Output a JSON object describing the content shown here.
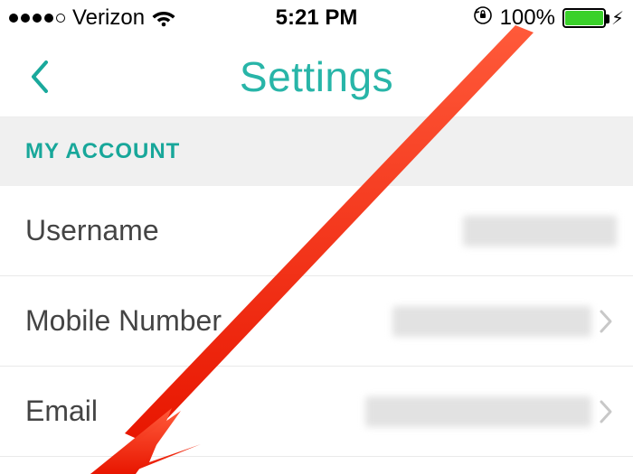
{
  "status_bar": {
    "carrier": "Verizon",
    "time": "5:21 PM",
    "battery_pct": "100%",
    "signal_filled": 4,
    "signal_total": 5,
    "wifi": true,
    "rotation_locked": true,
    "charging": true
  },
  "nav": {
    "title": "Settings"
  },
  "section": {
    "header": "MY ACCOUNT"
  },
  "rows": {
    "username": {
      "label": "Username"
    },
    "mobile": {
      "label": "Mobile Number"
    },
    "email": {
      "label": "Email"
    }
  },
  "accent_color": "#28b5a8",
  "annotation": {
    "type": "arrow",
    "color": "#ff2a18"
  }
}
